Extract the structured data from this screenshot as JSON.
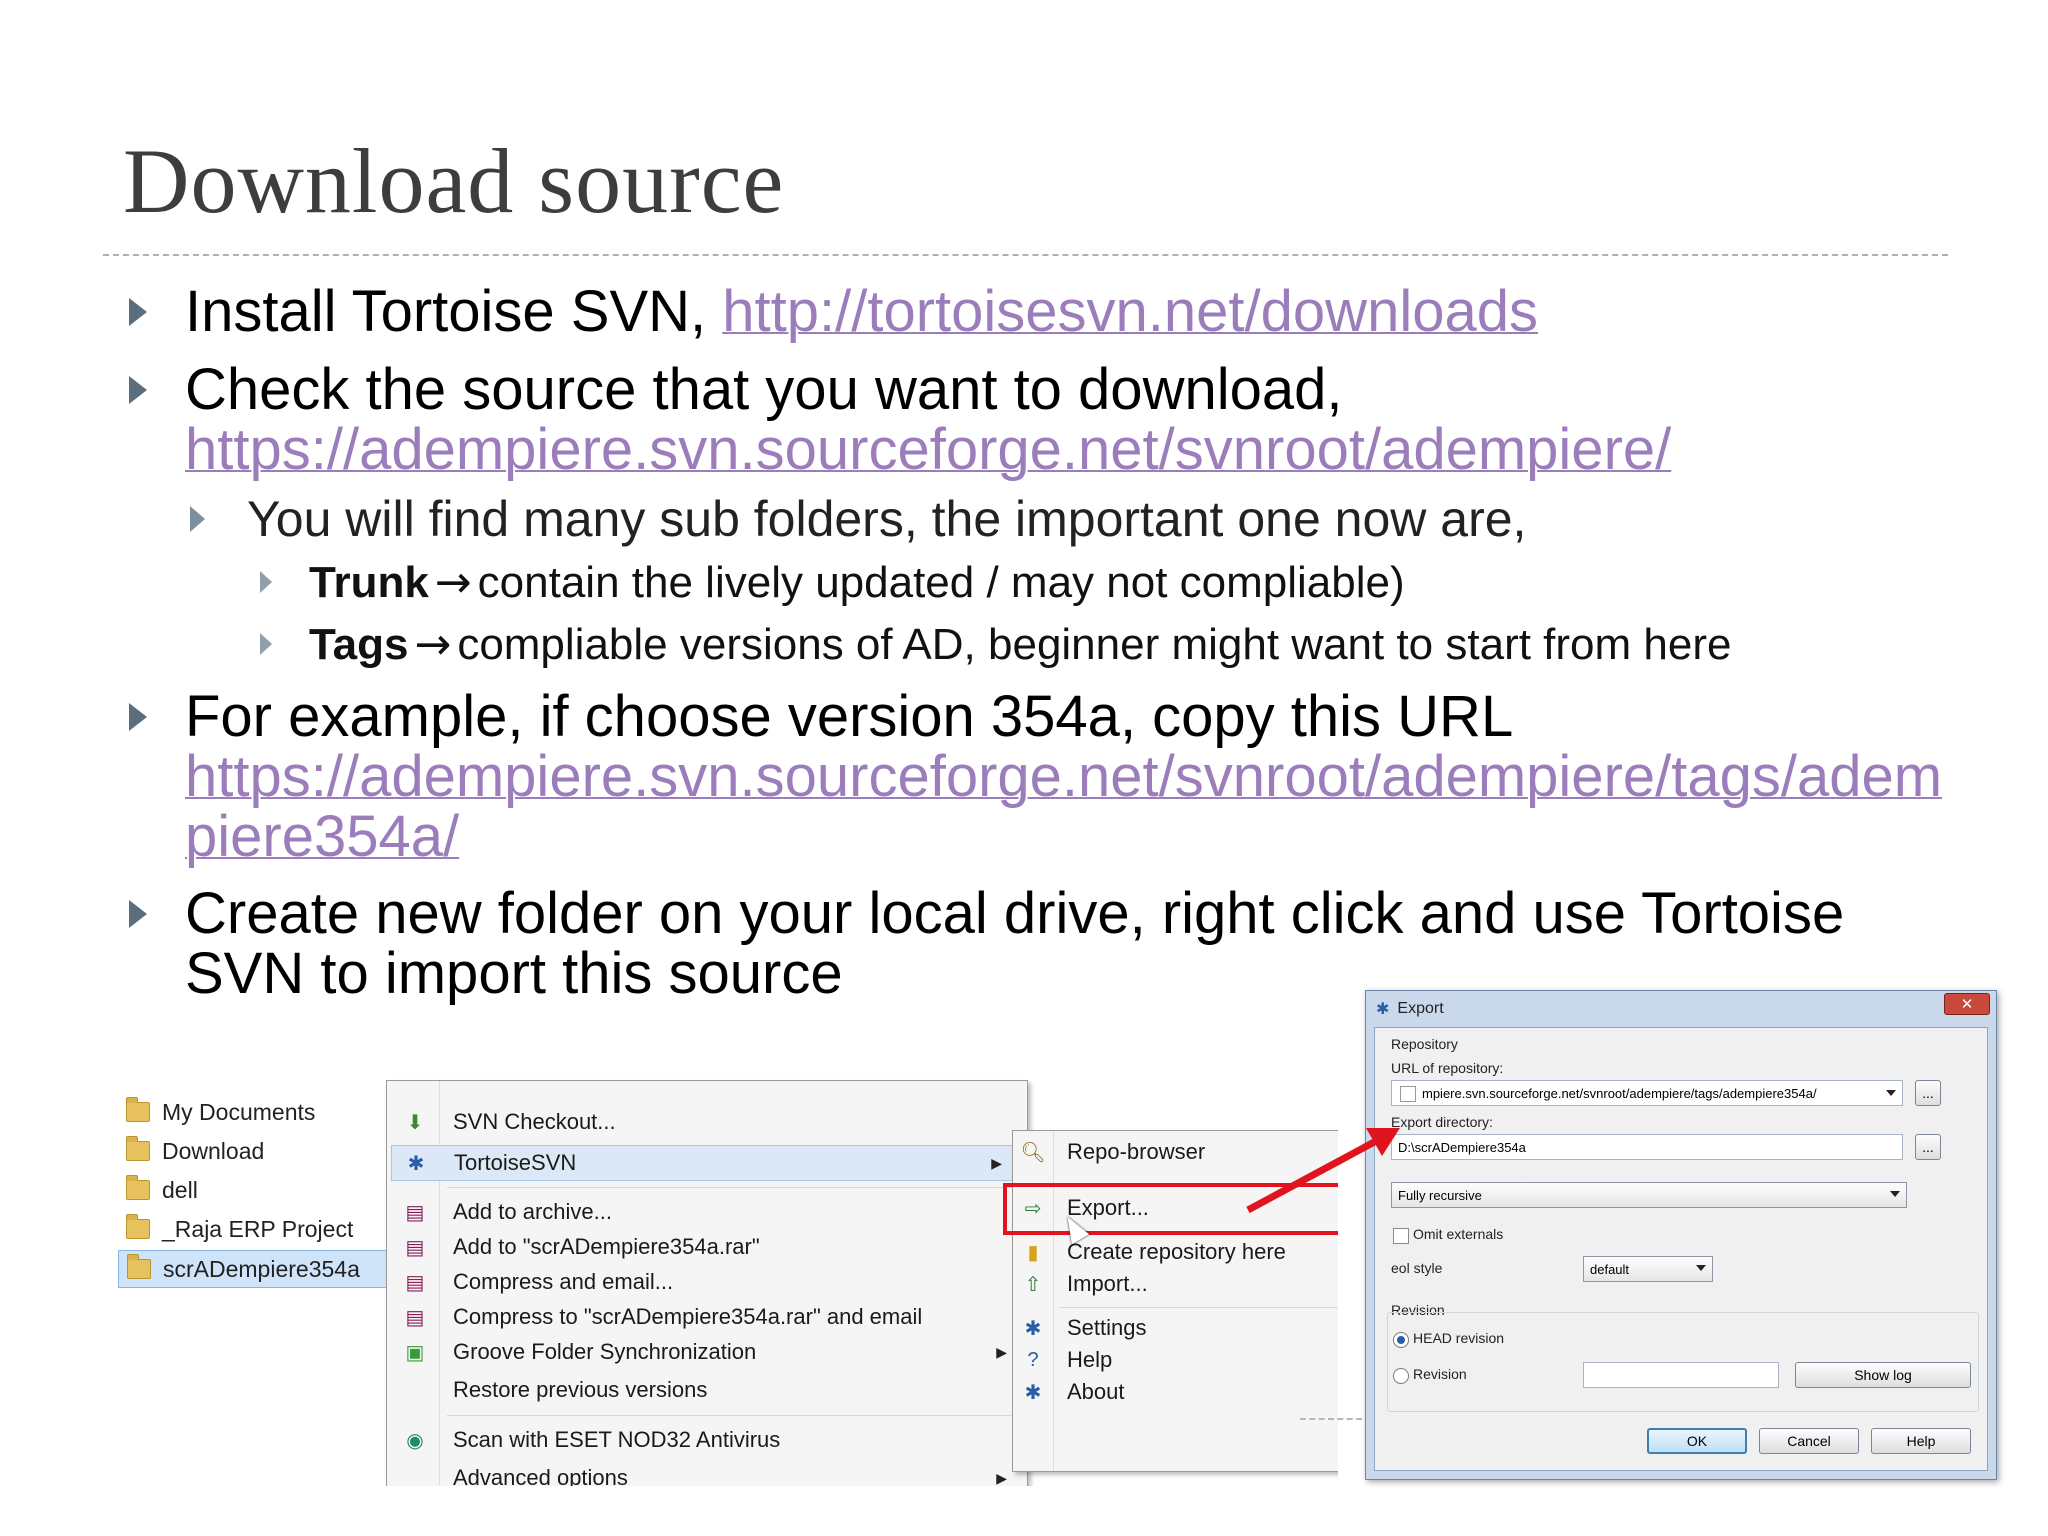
{
  "slide": {
    "title": "Download source",
    "b1_text": "Install Tortoise SVN, ",
    "b1_link": "http://tortoisesvn.net/downloads",
    "b2_text": "Check the source that you want to download,",
    "b2_link": "https://adempiere.svn.sourceforge.net/svnroot/adempiere/",
    "b2_sub": "You will find many sub folders, the important one now are,",
    "trunk_label": "Trunk",
    "trunk_text": "contain the lively updated / may not compliable)",
    "tags_label": "Tags",
    "tags_text": "compliable versions of AD, beginner might want to start from here",
    "arrow": "→",
    "b3_text": "For example, if choose version 354a, copy this URL",
    "b3_link_1": "https://adempiere.svn.sourceforge.net/svnroot/adempiere/tags/adem",
    "b3_link_2": "piere354a/",
    "b4_line1": "Create new folder on your local drive, right click  and use Tortoise",
    "b4_line2": "SVN to import this source"
  },
  "explorer": {
    "items": [
      "My Documents",
      "Download",
      "dell",
      "_Raja ERP Project",
      "scrADempiere354a"
    ]
  },
  "context_menu": {
    "items": [
      {
        "label": "SVN Checkout...",
        "icon": "svn-checkout-icon"
      },
      {
        "label": "TortoiseSVN",
        "icon": "tortoise-icon"
      },
      {
        "label": "Add to archive...",
        "icon": "winrar-icon"
      },
      {
        "label": "Add to \"scrADempiere354a.rar\"",
        "icon": "winrar-icon"
      },
      {
        "label": "Compress and email...",
        "icon": "winrar-icon"
      },
      {
        "label": "Compress to \"scrADempiere354a.rar\" and email",
        "icon": "winrar-icon"
      },
      {
        "label": "Groove Folder Synchronization",
        "icon": "groove-icon"
      },
      {
        "label": "Restore previous versions",
        "icon": ""
      },
      {
        "label": "Scan with ESET NOD32 Antivirus",
        "icon": "eset-icon"
      },
      {
        "label": "Advanced options",
        "icon": ""
      }
    ]
  },
  "tortoise_submenu": {
    "items": [
      {
        "label": "Repo-browser",
        "icon": "repo-browser-icon"
      },
      {
        "label": "Export...",
        "icon": "export-icon"
      },
      {
        "label": "Create repository here",
        "icon": "create-repo-icon"
      },
      {
        "label": "Import...",
        "icon": "import-icon"
      },
      {
        "label": "Settings",
        "icon": "settings-icon"
      },
      {
        "label": "Help",
        "icon": "help-icon"
      },
      {
        "label": "About",
        "icon": "about-icon"
      }
    ]
  },
  "export_dialog": {
    "title": "Export",
    "close": "✕",
    "repository_label": "Repository",
    "url_label": "URL of repository:",
    "url_value": "mpiere.svn.sourceforge.net/svnroot/adempiere/tags/adempiere354a/",
    "browse": "...",
    "export_dir_label": "Export directory:",
    "export_dir_value": "D:\\scrADempiere354a",
    "depth": "Fully recursive",
    "omit_externals": "Omit externals",
    "eol_label": "eol style",
    "eol_value": "default",
    "revision_group": "Revision",
    "head_revision": "HEAD revision",
    "revision": "Revision",
    "show_log": "Show log",
    "ok": "OK",
    "cancel": "Cancel",
    "help": "Help"
  },
  "colors": {
    "link": "#9b7dbb",
    "title": "#3d3d3d",
    "highlight_box": "#e0141e"
  }
}
